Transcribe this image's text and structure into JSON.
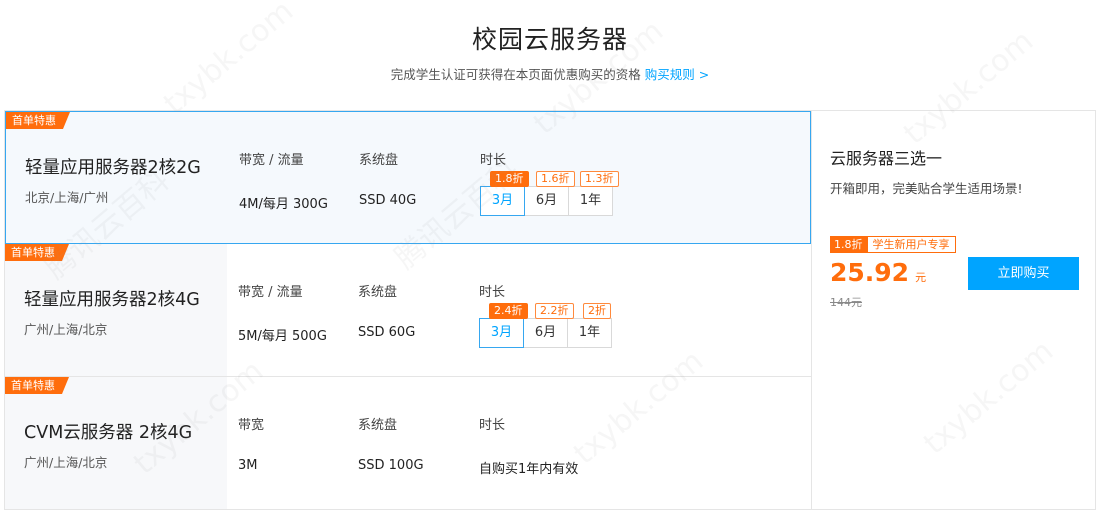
{
  "header": {
    "title": "校园云服务器",
    "subtitle": "完成学生认证可获得在本页面优惠购买的资格",
    "rule_link": "购买规则 >"
  },
  "columns": {
    "bandwidth_traffic": "带宽 / 流量",
    "bandwidth": "带宽",
    "disk": "系统盘",
    "duration": "时长"
  },
  "products": [
    {
      "ribbon": "首单特惠",
      "name": "轻量应用服务器2核2G",
      "region": "北京/上海/广州",
      "bandwidth": "4M/每月 300G",
      "disk": "SSD 40G",
      "durations": [
        {
          "label": "3月",
          "discount": "1.8折",
          "active": true
        },
        {
          "label": "6月",
          "discount": "1.6折",
          "active": false
        },
        {
          "label": "1年",
          "discount": "1.3折",
          "active": false
        }
      ]
    },
    {
      "ribbon": "首单特惠",
      "name": "轻量应用服务器2核4G",
      "region": "广州/上海/北京",
      "bandwidth": "5M/每月 500G",
      "disk": "SSD 60G",
      "durations": [
        {
          "label": "3月",
          "discount": "2.4折",
          "active": true
        },
        {
          "label": "6月",
          "discount": "2.2折",
          "active": false
        },
        {
          "label": "1年",
          "discount": "2折",
          "active": false
        }
      ]
    },
    {
      "ribbon": "首单特惠",
      "name": "CVM云服务器 2核4G",
      "region": "广州/上海/北京",
      "bandwidth": "3M",
      "disk": "SSD 100G",
      "duration_text": "自购买1年内有效"
    }
  ],
  "side": {
    "title": "云服务器三选一",
    "desc": "开箱即用，完美贴合学生适用场景!",
    "discount_tag": "1.8折",
    "new_user_tag": "学生新用户专享",
    "price": "25.92",
    "unit": "元",
    "original_price": "144元",
    "buy_label": "立即购买"
  },
  "watermark": {
    "domain": "txybk.com",
    "name": "腾讯云百科"
  },
  "colors": {
    "accent_blue": "#00a4ff",
    "accent_orange": "#ff6d0c",
    "selected_border": "#36a7f0"
  }
}
